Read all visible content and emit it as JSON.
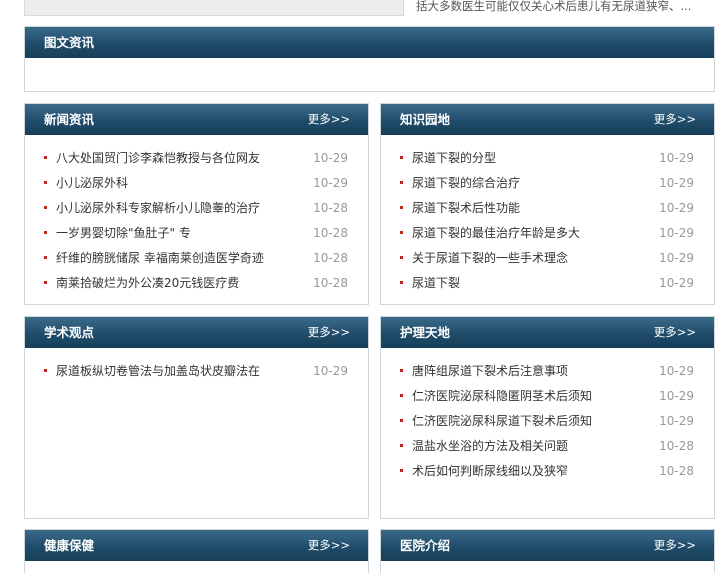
{
  "top": {
    "snippet": "括大多数医生可能仅仅关心术后患儿有无尿道狭窄、..."
  },
  "photo_news": {
    "title": "图文资讯"
  },
  "news": {
    "title": "新闻资讯",
    "more": "更多>>",
    "items": [
      {
        "text": "八大处国贸门诊李森恺教授与各位网友",
        "date": "10-29"
      },
      {
        "text": "小儿泌尿外科",
        "date": "10-29"
      },
      {
        "text": "小儿泌尿外科专家解析小儿隐睾的治疗",
        "date": "10-28"
      },
      {
        "text": "一岁男婴切除\"鱼肚子\" 专",
        "date": "10-28"
      },
      {
        "text": "纤维的膀胱储尿 幸福南莱创造医学奇迹",
        "date": "10-28"
      },
      {
        "text": "南莱拾破烂为外公凑20元钱医疗费",
        "date": "10-28"
      }
    ]
  },
  "knowledge": {
    "title": "知识园地",
    "more": "更多>>",
    "items": [
      {
        "text": "尿道下裂的分型",
        "date": "10-29"
      },
      {
        "text": "尿道下裂的综合治疗",
        "date": "10-29"
      },
      {
        "text": "尿道下裂术后性功能",
        "date": "10-29"
      },
      {
        "text": "尿道下裂的最佳治疗年龄是多大",
        "date": "10-29"
      },
      {
        "text": "关于尿道下裂的一些手术理念",
        "date": "10-29"
      },
      {
        "text": "尿道下裂",
        "date": "10-29"
      }
    ]
  },
  "academic": {
    "title": "学术观点",
    "more": "更多>>",
    "items": [
      {
        "text": "尿道板纵切卷管法与加盖岛状皮瓣法在",
        "date": "10-29"
      }
    ]
  },
  "nursing": {
    "title": "护理天地",
    "more": "更多>>",
    "items": [
      {
        "text": "唐阵组尿道下裂术后注意事项",
        "date": "10-29"
      },
      {
        "text": "仁济医院泌尿科隐匿阴茎术后须知",
        "date": "10-29"
      },
      {
        "text": "仁济医院泌尿科尿道下裂术后须知",
        "date": "10-29"
      },
      {
        "text": "温盐水坐浴的方法及相关问题",
        "date": "10-28"
      },
      {
        "text": "术后如何判断尿线细以及狭窄",
        "date": "10-28"
      }
    ]
  },
  "health": {
    "title": "健康保健",
    "more": "更多>>"
  },
  "hospital": {
    "title": "医院介绍",
    "more": "更多>>"
  }
}
